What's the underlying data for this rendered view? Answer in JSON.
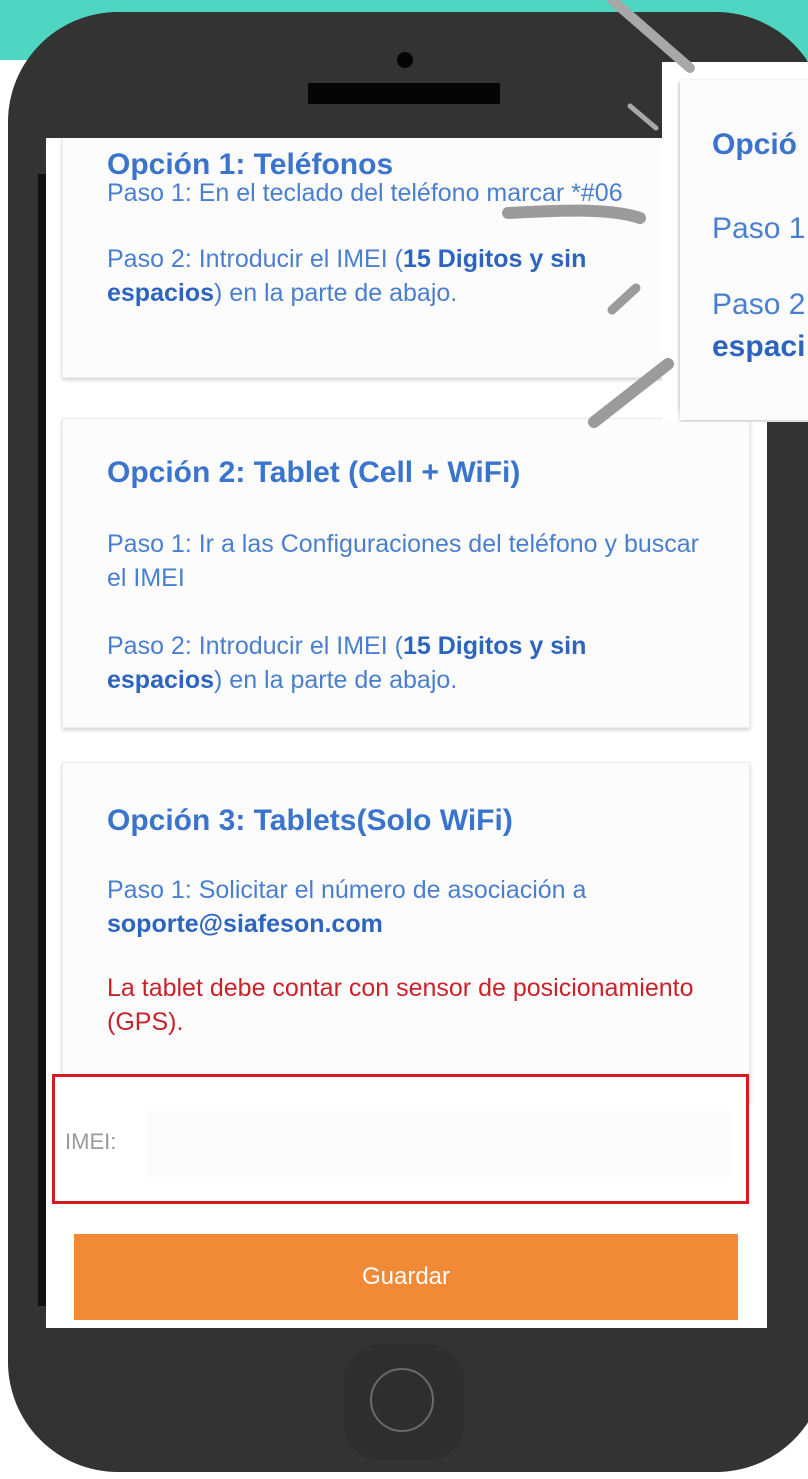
{
  "card1": {
    "title": "Opción 1: Teléfonos",
    "step1": "Paso 1: En el teclado del teléfono marcar *#06",
    "step2_pre": "Paso 2: Introducir el IMEI (",
    "step2_bold1": "15 Digitos y sin",
    "step2_bold2": "espacios",
    "step2_post": ") en la parte de abajo."
  },
  "card2": {
    "title": "Opción 2: Tablet (Cell + WiFi)",
    "step1": "Paso 1: Ir a las Configuraciones del teléfono y buscar el IMEI",
    "step2_pre": "Paso 2: Introducir el IMEI (",
    "step2_bold1": "15 Digitos y sin",
    "step2_bold2": "espacios",
    "step2_post": ") en la parte de abajo."
  },
  "card3": {
    "title": "Opción 3: Tablets(Solo WiFi)",
    "step1": "Paso 1: Solicitar el número de asociación a",
    "step1_email": "soporte@siafeson.com",
    "warning": "La tablet debe contar con sensor de posicionamiento (GPS)."
  },
  "imei": {
    "label": "IMEI:",
    "value": ""
  },
  "save_label": "Guardar",
  "overlay": {
    "title": "Opció",
    "line1": "Paso 1",
    "line2": "Paso 2",
    "line3": "espaci"
  },
  "colors": {
    "title_blue": "#3b74cc",
    "text_blue": "#4a7fd0",
    "warning_red": "#c9222a",
    "button_orange": "#f08a36",
    "highlight_red": "#d71920",
    "teal": "#4fd6c3",
    "phone_body": "#333333"
  }
}
